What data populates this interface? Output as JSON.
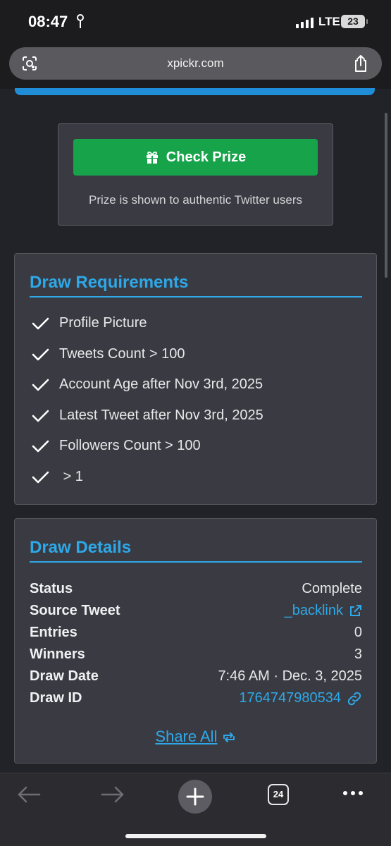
{
  "status_bar": {
    "time": "08:47",
    "network": "LTE",
    "battery": "23"
  },
  "browser": {
    "url": "xpickr.com",
    "open_tabs": "24"
  },
  "prize": {
    "button_label": "Check Prize",
    "note": "Prize is shown to authentic Twitter users"
  },
  "requirements": {
    "title": "Draw Requirements",
    "items": [
      "Profile Picture",
      "Tweets Count > 100",
      "Account Age after Nov 3rd, 2025",
      "Latest Tweet after Nov 3rd, 2025",
      "Followers Count > 100",
      " > 1"
    ]
  },
  "details": {
    "title": "Draw Details",
    "rows": [
      {
        "label": "Status",
        "value": "Complete"
      },
      {
        "label": "Source Tweet",
        "value": "_backlink"
      },
      {
        "label": "Entries",
        "value": "0"
      },
      {
        "label": "Winners",
        "value": "3"
      },
      {
        "label": "Draw Date",
        "value": "7:46 AM · Dec. 3, 2025"
      },
      {
        "label": "Draw ID",
        "value": "1764747980534"
      }
    ],
    "share_all_label": "Share All"
  },
  "colors": {
    "accent": "#2ea8e8",
    "prize_button": "#17a34a",
    "background": "#222328",
    "card": "#3a3b42"
  },
  "icons": [
    "location-arrow-icon",
    "signal-icon",
    "lens-icon",
    "share-icon",
    "gift-icon",
    "check-icon",
    "external-link-icon",
    "link-icon",
    "repeat-icon",
    "back-arrow-icon",
    "forward-arrow-icon",
    "plus-icon",
    "more-icon"
  ]
}
